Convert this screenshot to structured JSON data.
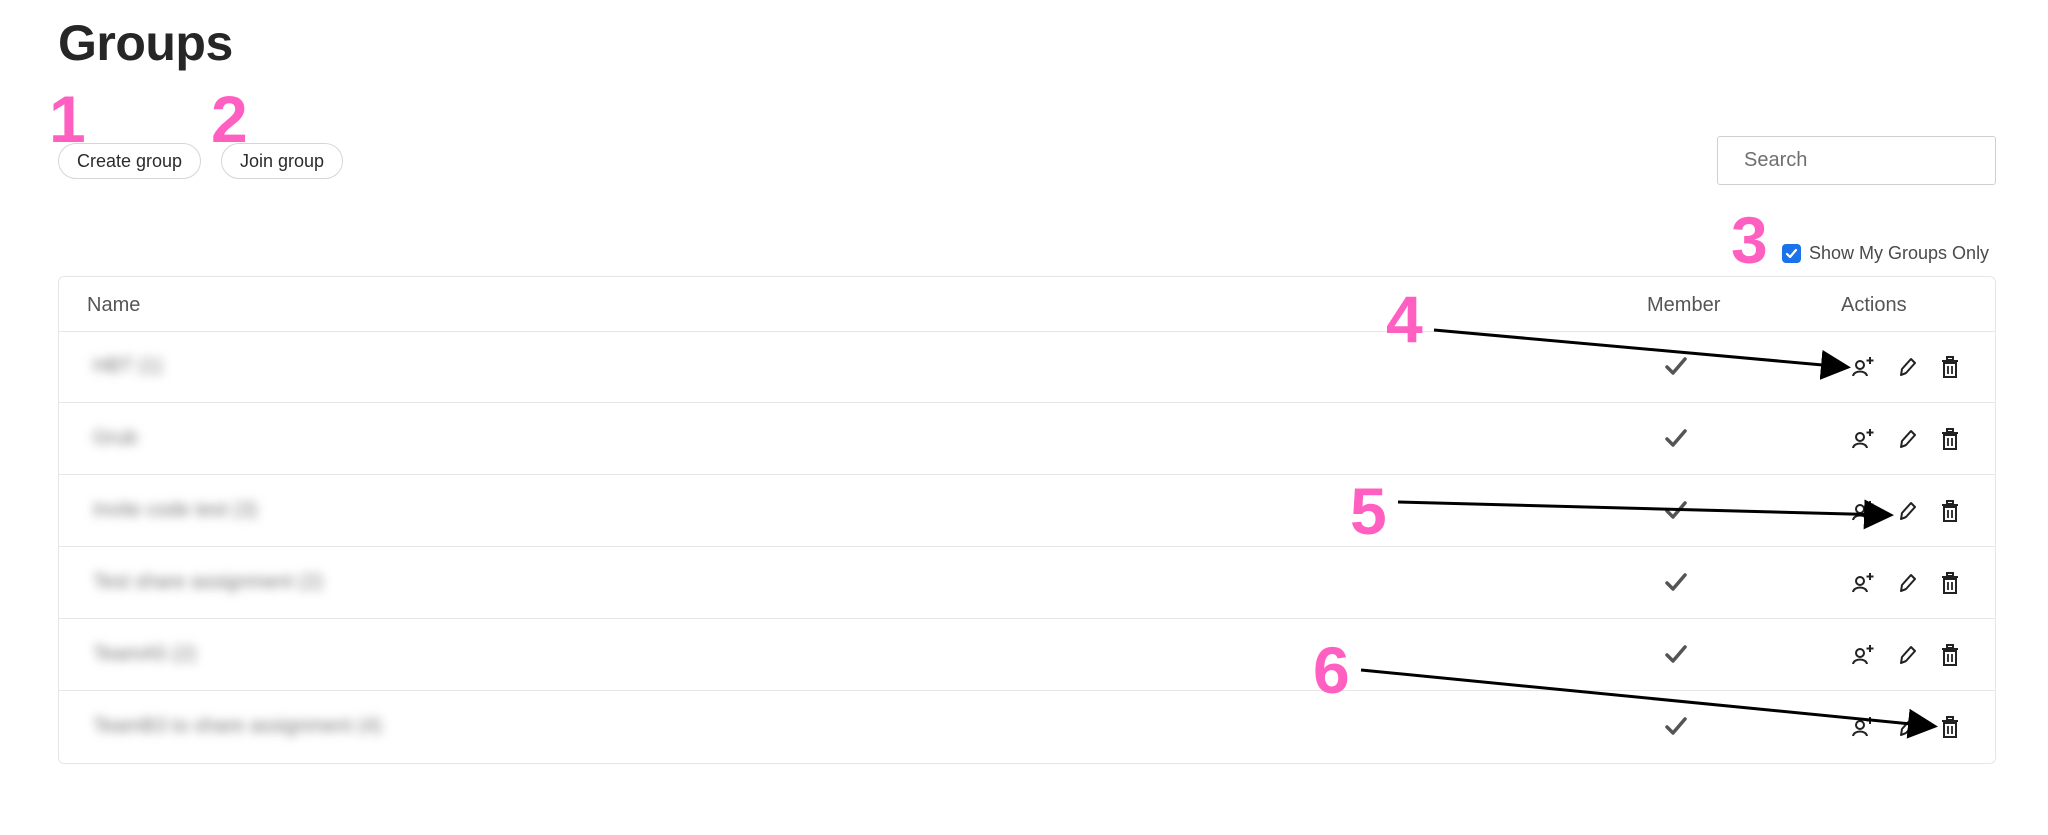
{
  "page": {
    "title": "Groups"
  },
  "toolbar": {
    "create_label": "Create group",
    "join_label": "Join group"
  },
  "search": {
    "placeholder": "Search",
    "value": "",
    "icon": "search-icon"
  },
  "filter": {
    "label": "Show My Groups Only",
    "checked": true,
    "accent": "#1a73e8"
  },
  "table": {
    "columns": [
      "Name",
      "Member",
      "Actions"
    ],
    "rows": [
      {
        "name": "HBT (1)",
        "member": true
      },
      {
        "name": "Grub",
        "member": true
      },
      {
        "name": "Invite code test (3)",
        "member": true
      },
      {
        "name": "Test share assignment (2)",
        "member": true
      },
      {
        "name": "TeamA5 (2)",
        "member": true
      },
      {
        "name": "TeamB3 to share assignment (4)",
        "member": true
      }
    ],
    "action_icons": [
      "add-member-icon",
      "edit-pencil-icon",
      "trash-icon"
    ]
  },
  "annotations": {
    "color": "#ff5fc1",
    "labels": [
      "1",
      "2",
      "3",
      "4",
      "5",
      "6"
    ]
  }
}
